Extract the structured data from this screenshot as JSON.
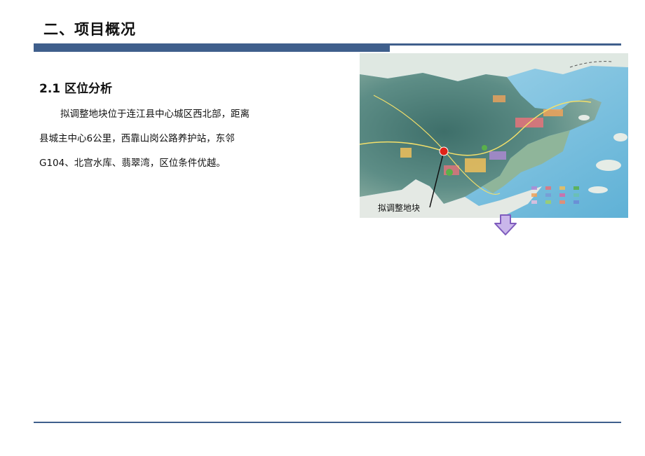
{
  "slide": {
    "title": "二、项目概况",
    "section_heading": "2.1 区位分析",
    "body_lines": [
      "拟调整地块位于连江县中心城区西北部，距离",
      "县城主中心6公里，西靠山岗公路养护站，东邻",
      "G104、北宫水库、翡翠湾，区位条件优越。"
    ],
    "map": {
      "marker_label": "拟调整地块",
      "marker_color": "#e02418"
    },
    "colors": {
      "accent_bar": "#3f5f8c",
      "arrow_fill": "#c9b6ea",
      "arrow_stroke": "#7e5bbd"
    },
    "icons": [
      "down-arrow-icon",
      "location-marker-icon"
    ]
  }
}
